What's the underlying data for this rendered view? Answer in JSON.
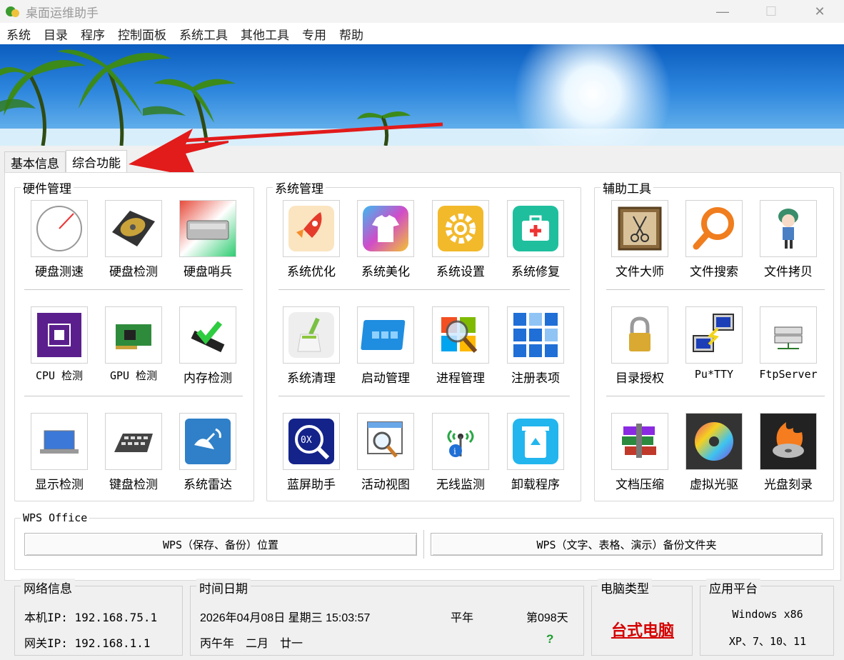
{
  "window": {
    "title": "桌面运维助手",
    "minimize": "—",
    "maximize": "☐",
    "close": "✕"
  },
  "menu": [
    "系统",
    "目录",
    "程序",
    "控制面板",
    "系统工具",
    "其他工具",
    "专用",
    "帮助"
  ],
  "tabs": [
    "基本信息",
    "综合功能"
  ],
  "hardware": {
    "legend": "硬件管理",
    "items": [
      "硬盘测速",
      "硬盘检测",
      "硬盘哨兵",
      "CPU 检测",
      "GPU 检测",
      "内存检测",
      "显示检测",
      "键盘检测",
      "系统雷达"
    ]
  },
  "system": {
    "legend": "系统管理",
    "items": [
      "系统优化",
      "系统美化",
      "系统设置",
      "系统修复",
      "系统清理",
      "启动管理",
      "进程管理",
      "注册表项",
      "蓝屏助手",
      "活动视图",
      "无线监测",
      "卸载程序"
    ]
  },
  "tools": {
    "legend": "辅助工具",
    "items": [
      "文件大师",
      "文件搜索",
      "文件拷贝",
      "目录授权",
      "Pu*TTY",
      "FtpServer",
      "文档压缩",
      "虚拟光驱",
      "光盘刻录"
    ]
  },
  "wps": {
    "legend": "WPS Office",
    "btn1": "WPS（保存、备份）位置",
    "btn2": "WPS（文字、表格、演示）备份文件夹"
  },
  "network": {
    "legend": "网络信息",
    "local_ip": "本机IP: 192.168.75.1",
    "gateway_ip": "网关IP: 192.168.1.1"
  },
  "datetime": {
    "legend": "时间日期",
    "date": "2026年04月08日 星期三 15:03:57",
    "year_type": "平年",
    "day_of_year": "第098天",
    "lunar": "丙午年　二月　廿一",
    "unknown": "?"
  },
  "pc_type": {
    "legend": "电脑类型",
    "value": "台式电脑"
  },
  "platform": {
    "legend": "应用平台",
    "os": "Windows x86",
    "versions": "XP、7、10、11"
  },
  "colors": {
    "accent_red": "#e21b1b",
    "pc_type_red": "#d40000"
  }
}
